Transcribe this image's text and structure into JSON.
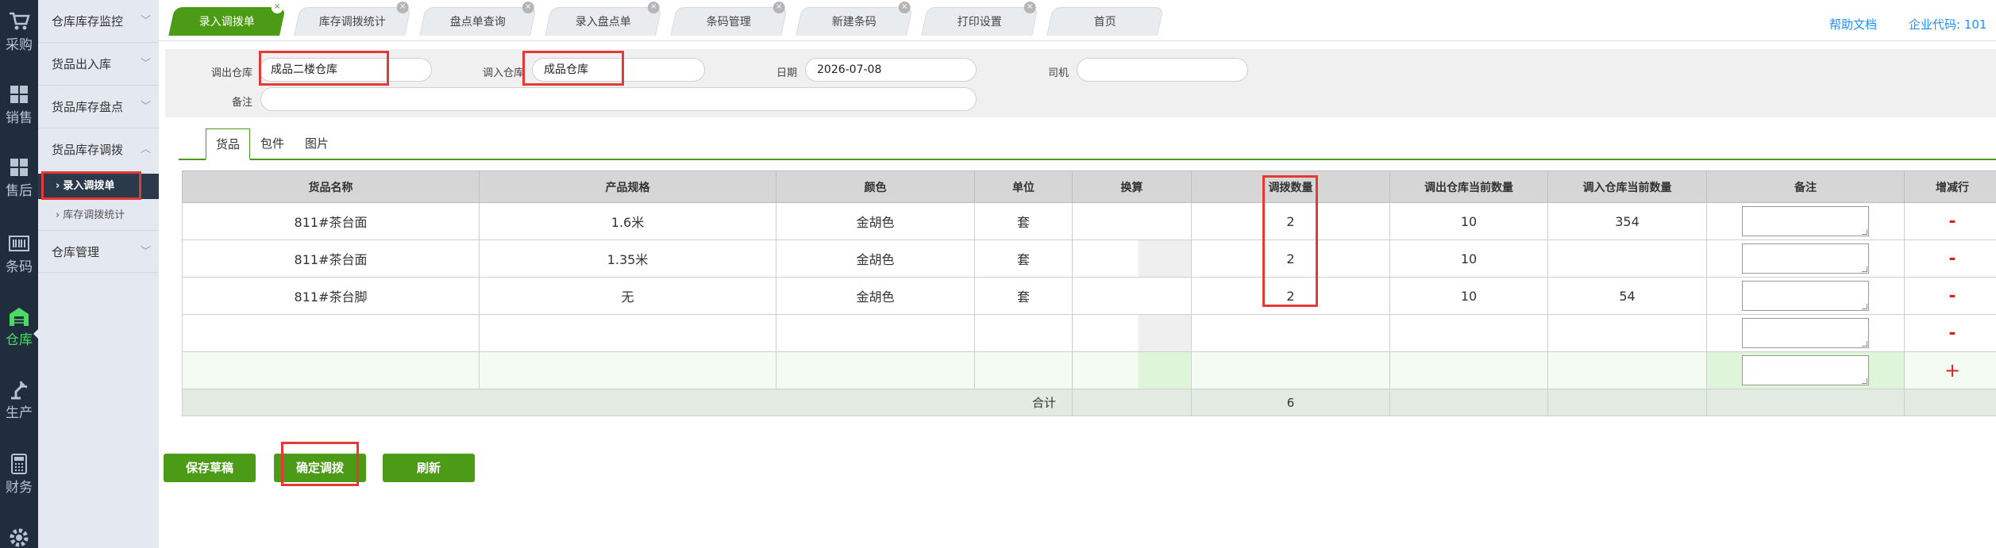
{
  "iconbar": {
    "items": [
      {
        "label": "采购",
        "icon": "cart-icon"
      },
      {
        "label": "销售",
        "icon": "grid-icon"
      },
      {
        "label": "售后",
        "icon": "grid-icon"
      },
      {
        "label": "条码",
        "icon": "barcode-icon"
      },
      {
        "label": "仓库",
        "icon": "warehouse-icon"
      },
      {
        "label": "生产",
        "icon": "robot-arm-icon"
      },
      {
        "label": "财务",
        "icon": "calculator-icon"
      }
    ]
  },
  "sidebar": {
    "items": [
      {
        "label": "仓库库存监控"
      },
      {
        "label": "货品出入库"
      },
      {
        "label": "货品库存盘点"
      },
      {
        "label": "货品库存调拨"
      },
      {
        "label": "仓库管理"
      }
    ],
    "subitems": [
      {
        "label": "录入调拨单"
      },
      {
        "label": "库存调拨统计"
      }
    ]
  },
  "tabs": [
    {
      "label": "录入调拨单"
    },
    {
      "label": "库存调拨统计"
    },
    {
      "label": "盘点单查询"
    },
    {
      "label": "录入盘点单"
    },
    {
      "label": "条码管理"
    },
    {
      "label": "新建条码"
    },
    {
      "label": "打印设置"
    },
    {
      "label": "首页"
    }
  ],
  "header": {
    "help": "帮助文档",
    "company_code": "企业代码: 101"
  },
  "form": {
    "out_warehouse_label": "调出仓库",
    "out_warehouse_value": "成品二楼仓库",
    "in_warehouse_label": "调入仓库",
    "in_warehouse_value": "成品仓库",
    "date_label": "日期",
    "date_value": "2026-07-08",
    "driver_label": "司机",
    "driver_value": "",
    "remark_label": "备注",
    "remark_value": ""
  },
  "subtabs": [
    "货品",
    "包件",
    "图片"
  ],
  "table": {
    "headers": [
      "货品名称",
      "产品规格",
      "颜色",
      "单位",
      "换算",
      "调拨数量",
      "调出仓库当前数量",
      "调入仓库当前数量",
      "备注",
      "增减行"
    ],
    "rows": [
      {
        "name": "811#茶台面",
        "spec": "1.6米",
        "color": "金胡色",
        "unit": "套",
        "qty": "2",
        "out_qty": "10",
        "in_qty": "354"
      },
      {
        "name": "811#茶台面",
        "spec": "1.35米",
        "color": "金胡色",
        "unit": "套",
        "qty": "2",
        "out_qty": "10",
        "in_qty": ""
      },
      {
        "name": "811#茶台脚",
        "spec": "无",
        "color": "金胡色",
        "unit": "套",
        "qty": "2",
        "out_qty": "10",
        "in_qty": "54"
      }
    ],
    "minus": "-",
    "plus": "+",
    "sum_label": "合计",
    "sum_value": "6"
  },
  "buttons": {
    "save_draft": "保存草稿",
    "confirm": "确定调拨",
    "refresh": "刷新"
  },
  "colors": {
    "accent": "#4c9b16",
    "highlight": "#e53935",
    "iconbar": "#1f2d3d",
    "sidebar": "#e4e8f0"
  }
}
